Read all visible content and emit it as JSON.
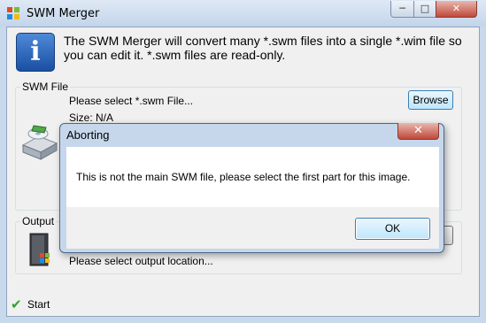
{
  "window": {
    "title": "SWM Merger",
    "controls": {
      "minimize": "minimize-icon",
      "maximize": "maximize-icon",
      "close": "close-icon"
    }
  },
  "info": {
    "icon": "info-icon",
    "message": "The SWM Merger will convert many *.swm files into a single *.wim file so you can edit it. *.swm files are read-only."
  },
  "swm_file": {
    "group_title": "SWM File",
    "prompt": "Please select *.swm File...",
    "size": "Size: N/A",
    "browse_label": "Browse",
    "icon": "drive-icon"
  },
  "output": {
    "group_title": "Output",
    "prompt": "Please select output location...",
    "icon": "windows-door-icon"
  },
  "start": {
    "label": "Start",
    "icon": "checkmark-icon"
  },
  "dialog": {
    "title": "Aborting",
    "message": "This is not the main SWM file, please select the first part for this image.",
    "ok_label": "OK",
    "close_icon": "close-icon"
  },
  "colors": {
    "accent": "#3c7fb1",
    "close_red": "#c0493a",
    "start_green": "#2fa52f",
    "title_bar": "#c9d9ec"
  }
}
